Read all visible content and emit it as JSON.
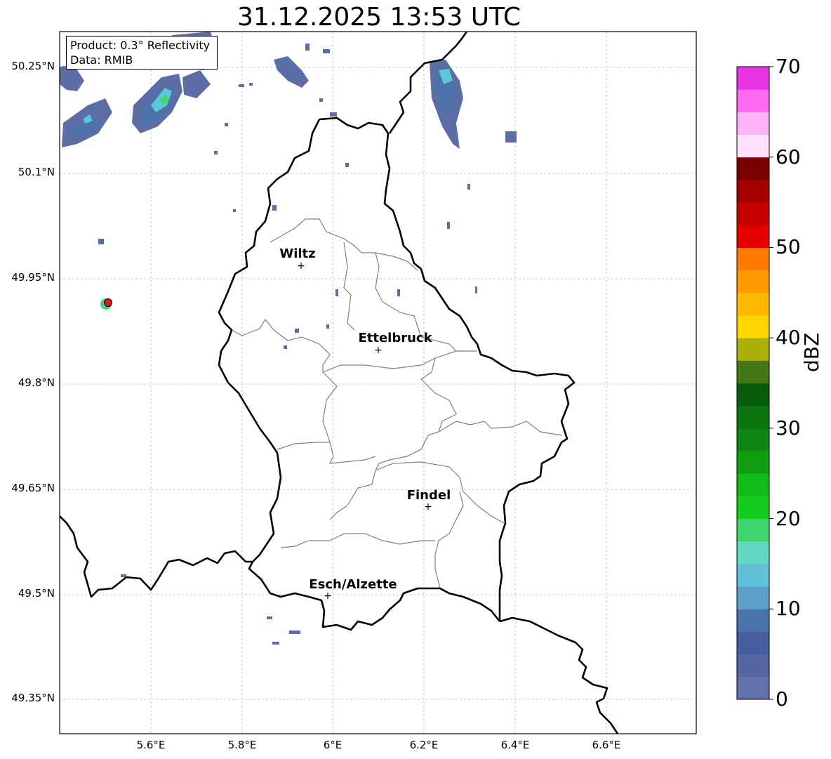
{
  "title": "31.12.2025 13:53 UTC",
  "info": {
    "product": "Product: 0.3° Reflectivity",
    "data": "Data: RMIB"
  },
  "latitude_labels": [
    "50.25°N",
    "50.1°N",
    "49.95°N",
    "49.8°N",
    "49.65°N",
    "49.5°N",
    "49.35°N"
  ],
  "longitude_labels": [
    "5.6°E",
    "5.8°E",
    "6°E",
    "6.2°E",
    "6.4°E",
    "6.6°E"
  ],
  "cities": [
    {
      "name": "Wiltz",
      "lon": 5.93,
      "lat": 49.966
    },
    {
      "name": "Ettelbruck",
      "lon": 6.1,
      "lat": 49.847
    },
    {
      "name": "Findel",
      "lon": 6.21,
      "lat": 49.623
    },
    {
      "name": "Esch/Alzette",
      "lon": 5.99,
      "lat": 49.5
    }
  ],
  "radar_site": {
    "lon": 5.505,
    "lat": 49.914,
    "color": "#e31b1b"
  },
  "colorbar": {
    "label": "dBZ",
    "min": 0,
    "max": 70,
    "ticks": [
      "0",
      "10",
      "20",
      "30",
      "40",
      "50",
      "60",
      "70"
    ],
    "colors": [
      "#6372a8",
      "#5666a0",
      "#465d9f",
      "#4a73ab",
      "#5b9ec8",
      "#62c0db",
      "#64d6c4",
      "#3fd66e",
      "#14cc1e",
      "#12bb19",
      "#109d12",
      "#0f8613",
      "#0b7411",
      "#085d0d",
      "#457714",
      "#abb00a",
      "#fdd600",
      "#fdb800",
      "#fd9a00",
      "#fd7c00",
      "#e50000",
      "#c60000",
      "#a40000",
      "#7a0000",
      "#fde0fb",
      "#fdb3f8",
      "#fc6cf2",
      "#e933e5"
    ]
  },
  "reflectivity_cells": [
    {
      "lon": 5.62,
      "lat": 50.21,
      "dbz": 19
    },
    {
      "lon": 5.63,
      "lat": 50.2,
      "dbz": 14
    },
    {
      "lon": 5.57,
      "lat": 50.19,
      "dbz": 12
    },
    {
      "lon": 5.47,
      "lat": 50.18,
      "dbz": 12
    },
    {
      "lon": 6.24,
      "lat": 50.24,
      "dbz": 14
    },
    {
      "lon": 5.5,
      "lat": 49.914,
      "dbz": 18
    }
  ],
  "colors": {
    "grid": "#b5b5b5",
    "border": "#000000",
    "canton": "#808080"
  }
}
